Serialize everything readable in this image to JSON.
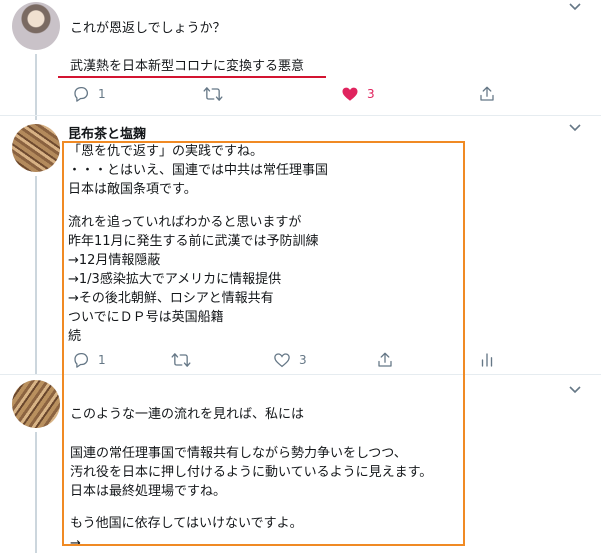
{
  "tweets": [
    {
      "lines": [
        "これが恩返しでしょうか？",
        "",
        "武漢熱を日本新型コロナに変換する悪意"
      ],
      "actions": {
        "reply": "1",
        "retweet": "",
        "like": "3",
        "share": ""
      }
    },
    {
      "author": "昆布茶と塩麹",
      "lines": [
        "「恩を仇で返す」の実践ですね。",
        "・・・とはいえ、国連では中共は常任理事国",
        "日本は敵国条項です。",
        "",
        "流れを追っていればわかると思いますが",
        "昨年11月に発生する前に武漢では予防訓練",
        "→12月情報隠蔽",
        "→1/3感染拡大でアメリカに情報提供",
        "→その後北朝鮮、ロシアと情報共有",
        "ついでにＤＰ号は英国船籍",
        "続"
      ],
      "actions": {
        "reply": "1",
        "retweet": "",
        "like": "3",
        "share": ""
      }
    },
    {
      "lines": [
        "このような一連の流れを見れば、私には",
        "",
        "国連の常任理事国で情報共有しながら勢力争いをしつつ、",
        "汚れ役を日本に押し付けるように動いているように見えます。",
        "日本は最終処理場ですね。",
        "",
        "もう他国に依存してはいけないですよ。",
        "→"
      ]
    }
  ],
  "colors": {
    "like_active": "#e0245e",
    "icon_gray": "#657786",
    "highlight_box": "#f08a24",
    "underline": "#d31431"
  },
  "icons": [
    "reply-icon",
    "retweet-icon",
    "heart-icon",
    "share-icon",
    "analytics-icon",
    "chevron-down-icon"
  ]
}
